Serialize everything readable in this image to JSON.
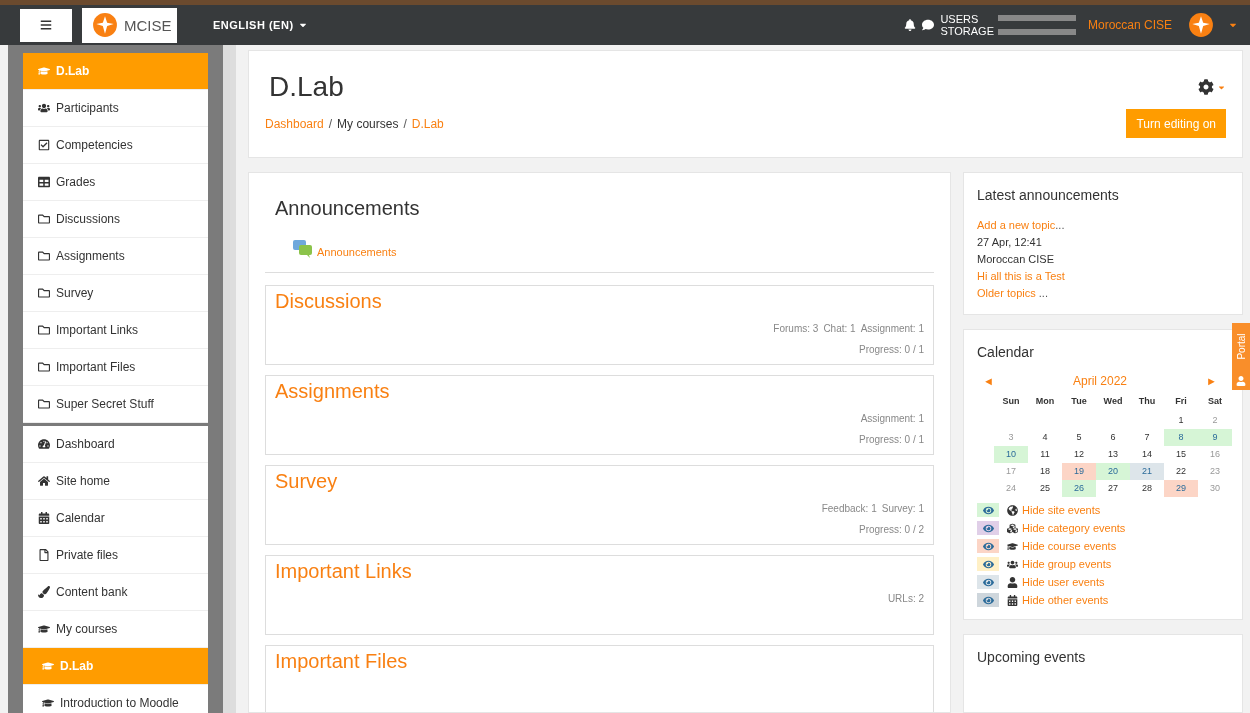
{
  "topbar": {
    "brand": "MCISE",
    "language": "ENGLISH (EN)",
    "quota_labels": [
      "USERS",
      "STORAGE"
    ],
    "user": "Moroccan CISE"
  },
  "sidebar": {
    "groups": [
      {
        "items": [
          {
            "label": "D.Lab",
            "kind": "course",
            "selected": true
          },
          {
            "label": "Participants",
            "kind": "users",
            "selected": false
          },
          {
            "label": "Competencies",
            "kind": "check",
            "selected": false
          },
          {
            "label": "Grades",
            "kind": "table",
            "selected": false
          },
          {
            "label": "Discussions",
            "kind": "folder",
            "selected": false
          },
          {
            "label": "Assignments",
            "kind": "folder",
            "selected": false
          },
          {
            "label": "Survey",
            "kind": "folder",
            "selected": false
          },
          {
            "label": "Important Links",
            "kind": "folder",
            "selected": false
          },
          {
            "label": "Important Files",
            "kind": "folder",
            "selected": false
          },
          {
            "label": "Super Secret Stuff",
            "kind": "folder",
            "selected": false
          }
        ]
      },
      {
        "items": [
          {
            "label": "Dashboard",
            "kind": "dashboard",
            "selected": false
          },
          {
            "label": "Site home",
            "kind": "home",
            "selected": false
          },
          {
            "label": "Calendar",
            "kind": "calendar",
            "selected": false
          },
          {
            "label": "Private files",
            "kind": "file",
            "selected": false
          },
          {
            "label": "Content bank",
            "kind": "brush",
            "selected": false
          },
          {
            "label": "My courses",
            "kind": "course",
            "selected": false,
            "children": [
              {
                "label": "D.Lab",
                "kind": "course",
                "selected": true
              },
              {
                "label": "Introduction to Moodle",
                "kind": "course",
                "selected": false
              }
            ]
          }
        ]
      }
    ]
  },
  "header": {
    "title": "D.Lab",
    "separator": "/",
    "breadcrumb": [
      {
        "label": "Dashboard",
        "link": true
      },
      {
        "label": "My courses",
        "link": false
      },
      {
        "label": "D.Lab",
        "link": true
      }
    ],
    "edit_button": "Turn editing on"
  },
  "announcements": {
    "title": "Announcements",
    "link": "Announcements"
  },
  "sections": [
    {
      "title": "Discussions",
      "activities": [
        "Forums: 3",
        "Chat: 1",
        "Assignment: 1"
      ],
      "progress": "Progress: 0 / 1"
    },
    {
      "title": "Assignments",
      "activities": [
        "Assignment: 1"
      ],
      "progress": "Progress: 0 / 1"
    },
    {
      "title": "Survey",
      "activities": [
        "Feedback: 1",
        "Survey: 1"
      ],
      "progress": "Progress: 0 / 2"
    },
    {
      "title": "Important Links",
      "activities": [
        "URLs: 2"
      ]
    },
    {
      "title": "Important Files"
    }
  ],
  "latest": {
    "title": "Latest announcements",
    "add_link": "Add a new topic",
    "add_suffix": "...",
    "date": "27 Apr, 12:41",
    "author": "Moroccan CISE",
    "post": "Hi all this is a Test",
    "older_link": "Older topics",
    "older_suffix": "..."
  },
  "calendar": {
    "title": "Calendar",
    "month": "April 2022",
    "prev": "◄",
    "next": "►",
    "weekdays": [
      "Sun",
      "Mon",
      "Tue",
      "Wed",
      "Thu",
      "Fri",
      "Sat"
    ],
    "weeks": [
      [
        {
          "day": "1"
        },
        {
          "day": "2"
        }
      ],
      [
        {
          "day": "3"
        },
        {
          "day": "4"
        },
        {
          "day": "5"
        },
        {
          "day": "6"
        },
        {
          "day": "7"
        },
        {
          "day": "8",
          "color": "#d6f5d6"
        },
        {
          "day": "9",
          "color": "#d6f5d6"
        }
      ],
      [
        {
          "day": "10",
          "color": "#d6f5d6"
        },
        {
          "day": "11"
        },
        {
          "day": "12"
        },
        {
          "day": "13"
        },
        {
          "day": "14"
        },
        {
          "day": "15"
        },
        {
          "day": "16"
        }
      ],
      [
        {
          "day": "17"
        },
        {
          "day": "18"
        },
        {
          "day": "19",
          "color": "#fcd5c6"
        },
        {
          "day": "20",
          "color": "#d6f5d6"
        },
        {
          "day": "21",
          "color": "#dde5ea"
        },
        {
          "day": "22"
        },
        {
          "day": "23"
        }
      ],
      [
        {
          "day": "24"
        },
        {
          "day": "25"
        },
        {
          "day": "26",
          "color": "#d6f5d6"
        },
        {
          "day": "27"
        },
        {
          "day": "28"
        },
        {
          "day": "29",
          "color": "#fcd5c6"
        },
        {
          "day": "30"
        }
      ]
    ],
    "filters": [
      {
        "label": "Hide site events",
        "kind": "globe",
        "color": "#d6f5d6"
      },
      {
        "label": "Hide category events",
        "kind": "cubes",
        "color": "#e0cfe8"
      },
      {
        "label": "Hide course events",
        "kind": "course",
        "color": "#fcd5c6"
      },
      {
        "label": "Hide group events",
        "kind": "users",
        "color": "#fff0c6"
      },
      {
        "label": "Hide user events",
        "kind": "user",
        "color": "#dde5ea"
      },
      {
        "label": "Hide other events",
        "kind": "calendar",
        "color": "#ced6dc"
      }
    ]
  },
  "upcoming": {
    "title": "Upcoming events"
  },
  "portal_tab": "Portal"
}
